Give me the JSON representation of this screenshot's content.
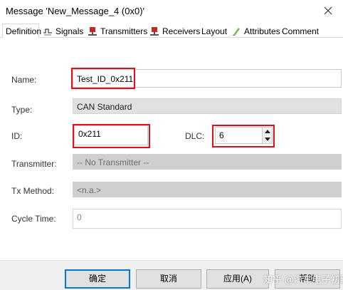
{
  "window": {
    "title": "Message 'New_Message_4 (0x0)'"
  },
  "tabs": [
    {
      "label": "Definition",
      "icon": "none"
    },
    {
      "label": "Signals",
      "icon": "signals-icon"
    },
    {
      "label": "Transmitters",
      "icon": "transmitter-node-icon"
    },
    {
      "label": "Receivers",
      "icon": "receiver-node-icon"
    },
    {
      "label": "Layout",
      "icon": "none"
    },
    {
      "label": "Attributes",
      "icon": "attributes-pen-icon"
    },
    {
      "label": "Comment",
      "icon": "none"
    }
  ],
  "form": {
    "name_label": "Name:",
    "name_value": "Test_ID_0x211",
    "type_label": "Type:",
    "type_value": "CAN Standard",
    "id_label": "ID:",
    "id_value": "0x211",
    "dlc_label": "DLC:",
    "dlc_value": "6",
    "transmitter_label": "Transmitter:",
    "transmitter_value": "-- No Transmitter --",
    "txmethod_label": "Tx Method:",
    "txmethod_value": "<n.a.>",
    "cycletime_label": "Cycle Time:",
    "cycletime_value": "0"
  },
  "buttons": {
    "ok": "确定",
    "cancel": "取消",
    "apply": "应用(A)",
    "help": "帮助"
  },
  "watermark": "知乎 @汽车电子初级",
  "colors": {
    "highlight": "#e0101a",
    "focus": "#0078d7"
  }
}
